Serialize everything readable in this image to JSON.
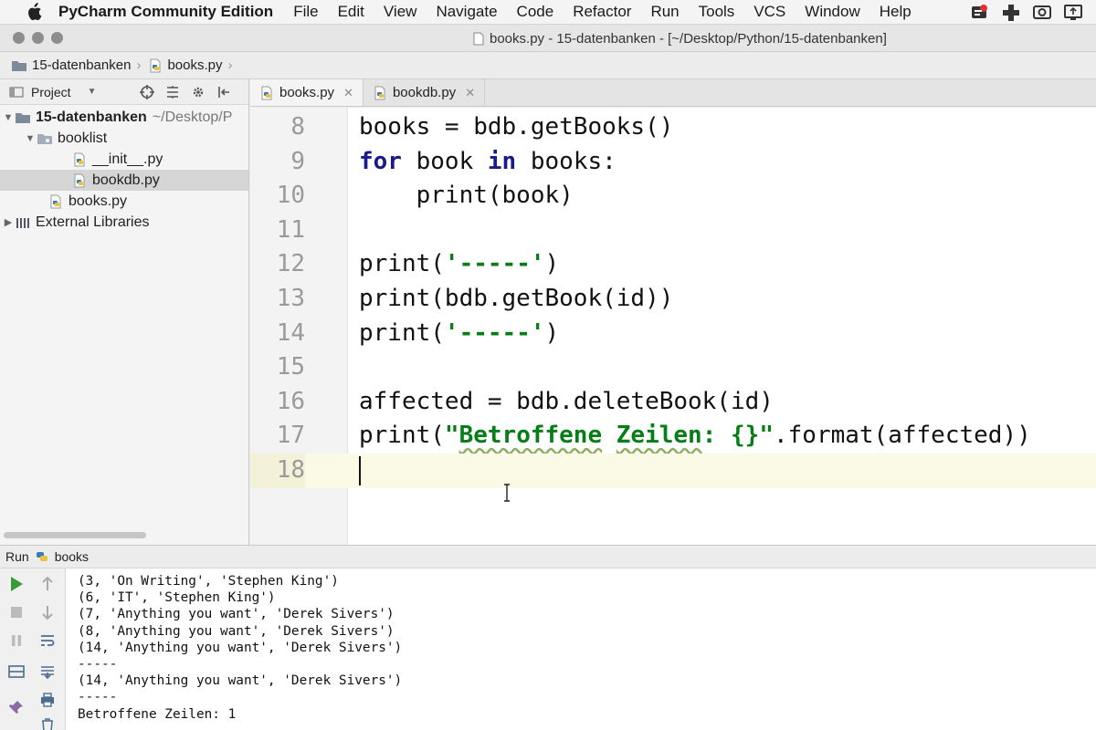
{
  "menubar": {
    "app_name": "PyCharm Community Edition",
    "items": [
      "File",
      "Edit",
      "View",
      "Navigate",
      "Code",
      "Refactor",
      "Run",
      "Tools",
      "VCS",
      "Window",
      "Help"
    ]
  },
  "window": {
    "title": "books.py - 15-datenbanken - [~/Desktop/Python/15-datenbanken]"
  },
  "breadcrumb": [
    "15-datenbanken",
    "books.py"
  ],
  "project_panel": {
    "header": "Project",
    "tree": [
      {
        "label": "15-datenbanken",
        "note": "~/Desktop/P",
        "type": "folder",
        "expanded": true,
        "bold": true
      },
      {
        "label": "booklist",
        "type": "folder",
        "expanded": true
      },
      {
        "label": "__init__.py",
        "type": "python"
      },
      {
        "label": "bookdb.py",
        "type": "python",
        "selected": true
      },
      {
        "label": "books.py",
        "type": "python"
      },
      {
        "label": "External Libraries",
        "type": "library",
        "expanded": false
      }
    ]
  },
  "tabs": [
    {
      "label": "books.py",
      "active": true
    },
    {
      "label": "bookdb.py",
      "active": false
    }
  ],
  "editor": {
    "current_line": 18,
    "lines": [
      {
        "n": "8",
        "text": "books = bdb.getBooks()"
      },
      {
        "n": "9",
        "text": "for book in books:"
      },
      {
        "n": "10",
        "text": "    print(book)"
      },
      {
        "n": "11",
        "text": ""
      },
      {
        "n": "12",
        "text": "print('-----')"
      },
      {
        "n": "13",
        "text": "print(bdb.getBook(id))"
      },
      {
        "n": "14",
        "text": "print('-----')"
      },
      {
        "n": "15",
        "text": ""
      },
      {
        "n": "16",
        "text": "affected = bdb.deleteBook(id)"
      },
      {
        "n": "17",
        "text": "print(\"Betroffene Zeilen: {}\".format(affected))"
      },
      {
        "n": "18",
        "text": ""
      }
    ]
  },
  "run_panel": {
    "label": "Run",
    "config": "books",
    "output": [
      "(3, 'On Writing', 'Stephen King')",
      "(6, 'IT', 'Stephen King')",
      "(7, 'Anything you want', 'Derek Sivers')",
      "(8, 'Anything you want', 'Derek Sivers')",
      "(14, 'Anything you want', 'Derek Sivers')",
      "-----",
      "(14, 'Anything you want', 'Derek Sivers')",
      "-----",
      "Betroffene Zeilen: 1"
    ]
  },
  "colors": {
    "keyword": "#1a1a8c",
    "string": "#067d17",
    "current_line": "#fbfae6",
    "run_green": "#3a9b3a"
  }
}
